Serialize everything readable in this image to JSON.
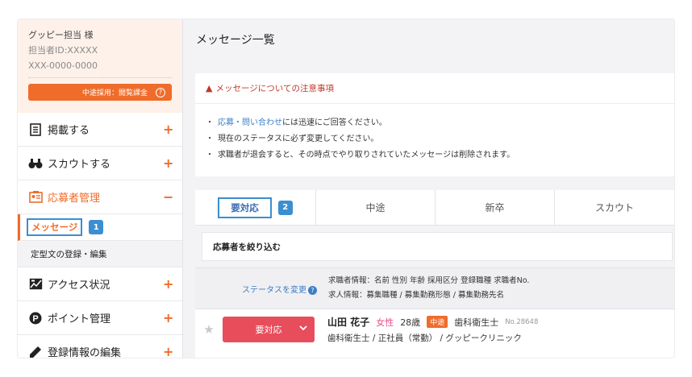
{
  "account": {
    "name": "グッピー担当 様",
    "staff_id": "担当者ID:XXXXX",
    "phone": "XXX-0000-0000",
    "plan_label": "中途採用：閲覧課金",
    "plan_help": "?"
  },
  "sidebar": {
    "items": [
      {
        "label": "掲載する",
        "icon": "document-icon",
        "toggle": "+"
      },
      {
        "label": "スカウトする",
        "icon": "binoculars-icon",
        "toggle": "+"
      },
      {
        "label": "応募者管理",
        "icon": "applicant-card-icon",
        "toggle": "−"
      },
      {
        "label": "アクセス状況",
        "icon": "chart-image-icon",
        "toggle": "+"
      },
      {
        "label": "ポイント管理",
        "icon": "point-icon",
        "toggle": "+"
      },
      {
        "label": "登録情報の編集",
        "icon": "pen-icon",
        "toggle": "+"
      }
    ],
    "sub_items": [
      {
        "label": "メッセージ",
        "badge": "1"
      },
      {
        "label": "定型文の登録・編集"
      }
    ]
  },
  "main": {
    "title": "メッセージ一覧",
    "notice": {
      "title": "メッセージについての注意事項",
      "lines": [
        {
          "link": "応募・問い合わせ",
          "text": "には迅速にご回答ください。"
        },
        {
          "text": "現在のステータスに必ず変更してください。"
        },
        {
          "text": "求職者が退会すると、その時点でやり取りされていたメッセージは削除されます。"
        }
      ]
    },
    "tabs": [
      {
        "label": "要対応",
        "badge": "2"
      },
      {
        "label": "中途"
      },
      {
        "label": "新卒"
      },
      {
        "label": "スカウト"
      }
    ],
    "filter_label": "応募者を絞り込む",
    "columns": {
      "status_change": "ステータスを変更",
      "help": "?",
      "seeker_info": "求職者情報：名前 性別 年齢 採用区分 登録職種 求職者No.",
      "job_info": "求人情報：募集職種 / 募集勤務形態 / 募集勤務先名"
    },
    "rows": [
      {
        "status": "要対応",
        "name": "山田 花子",
        "gender": "女性",
        "age": "28歳",
        "type": "中途",
        "job": "歯科衛生士",
        "no": "No.28648",
        "detail": "歯科衛生士 / 正社員（常勤） / グッピークリニック"
      }
    ]
  },
  "colors": {
    "accent": "#ef6c2a",
    "link": "#3b7fc4",
    "status": "#e84d5c",
    "highlight": "#3b8ed0"
  }
}
